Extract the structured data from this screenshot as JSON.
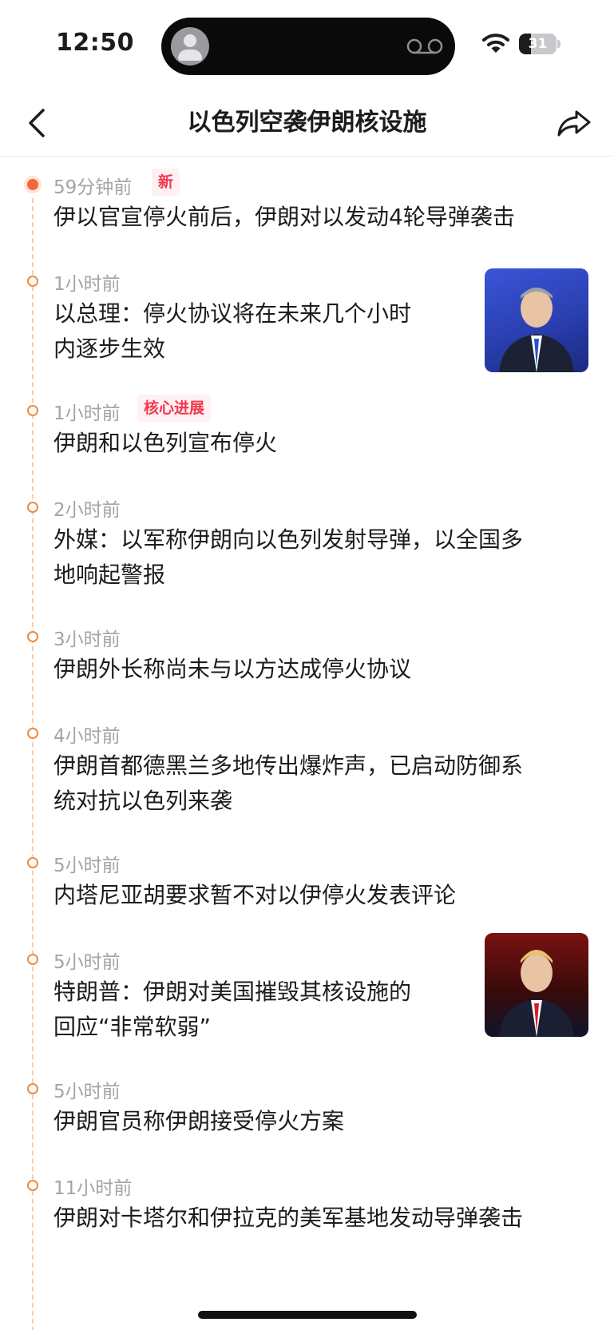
{
  "status_bar": {
    "time": "12:50",
    "battery": "31",
    "battery_level_percent": 31
  },
  "header": {
    "title": "以色列空袭伊朗核设施"
  },
  "timeline": [
    {
      "time": "59分钟前",
      "badge": "新",
      "title_lines": [
        "伊以官宣停火前后，伊朗对以发动4轮导弹袭击"
      ]
    },
    {
      "time": "1小时前",
      "title_lines": [
        "以总理：停火协议将在未来几个小时",
        "内逐步生效"
      ],
      "image_icon": "person-speaking-photo"
    },
    {
      "time": "1小时前",
      "badge": "核心进展",
      "title_lines": [
        "伊朗和以色列宣布停火"
      ]
    },
    {
      "time": "2小时前",
      "title_lines": [
        "外媒：以军称伊朗向以色列发射导弹，以全国多",
        "地响起警报"
      ]
    },
    {
      "time": "3小时前",
      "title_lines": [
        "伊朗外长称尚未与以方达成停火协议"
      ]
    },
    {
      "time": "4小时前",
      "title_lines": [
        "伊朗首都德黑兰多地传出爆炸声，已启动防御系",
        "统对抗以色列来袭"
      ]
    },
    {
      "time": "5小时前",
      "title_lines": [
        "内塔尼亚胡要求暂不对以伊停火发表评论"
      ]
    },
    {
      "time": "5小时前",
      "title_lines": [
        "特朗普：伊朗对美国摧毁其核设施的",
        "回应“非常软弱”"
      ],
      "image_icon": "person-speaking-photo"
    },
    {
      "time": "5小时前",
      "title_lines": [
        "伊朗官员称伊朗接受停火方案"
      ]
    },
    {
      "time": "11小时前",
      "title_lines": [
        "伊朗对卡塔尔和伊拉克的美军基地发动导弹袭击"
      ]
    }
  ],
  "colors": {
    "accent_orange": "#f08a3c",
    "badge_red": "#f0384f",
    "badge_bg": "#fff0f2",
    "time_gray": "#a4a4a8"
  }
}
